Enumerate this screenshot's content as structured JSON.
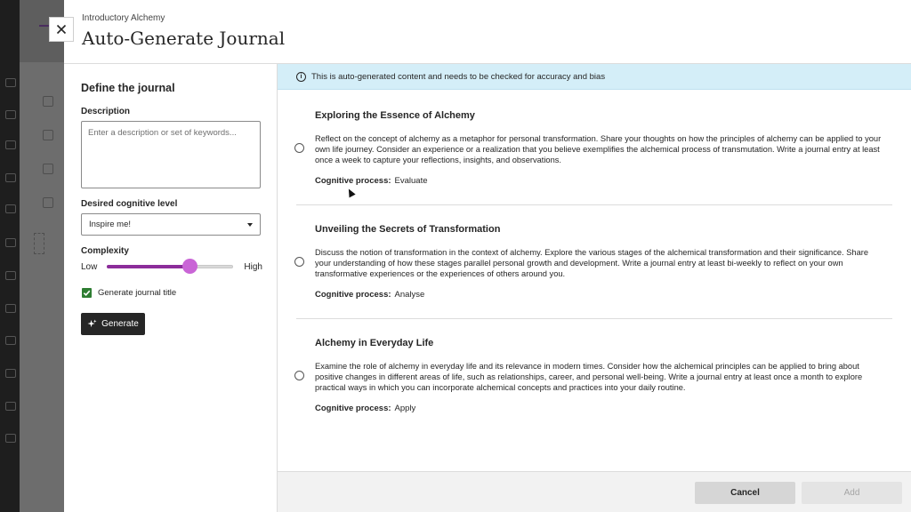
{
  "header": {
    "course": "Introductory Alchemy",
    "title": "Auto-Generate Journal"
  },
  "left": {
    "section_title": "Define the journal",
    "description_label": "Description",
    "description_placeholder": "Enter a description or set of keywords...",
    "cognitive_label": "Desired cognitive level",
    "cognitive_value": "Inspire me!",
    "complexity_label": "Complexity",
    "complexity_low": "Low",
    "complexity_high": "High",
    "complexity_fraction": 0.66,
    "generate_title_label": "Generate journal title",
    "generate_title_checked": true,
    "generate_button": "Generate"
  },
  "banner": {
    "text": "This is auto-generated content and needs to be checked for accuracy and bias"
  },
  "options": [
    {
      "title": "Exploring the Essence of Alchemy",
      "description": "Reflect on the concept of alchemy as a metaphor for personal transformation. Share your thoughts on how the principles of alchemy can be applied to your own life journey. Consider an experience or a realization that you believe exemplifies the alchemical process of transmutation. Write a journal entry at least once a week to capture your reflections, insights, and observations.",
      "cognitive_label": "Cognitive process:",
      "cognitive_value": "Evaluate"
    },
    {
      "title": "Unveiling the Secrets of Transformation",
      "description": "Discuss the notion of transformation in the context of alchemy. Explore the various stages of the alchemical transformation and their significance. Share your understanding of how these stages parallel personal growth and development. Write a journal entry at least bi-weekly to reflect on your own transformative experiences or the experiences of others around you.",
      "cognitive_label": "Cognitive process:",
      "cognitive_value": "Analyse"
    },
    {
      "title": "Alchemy in Everyday Life",
      "description": "Examine the role of alchemy in everyday life and its relevance in modern times. Consider how the alchemical principles can be applied to bring about positive changes in different areas of life, such as relationships, career, and personal well-being. Write a journal entry at least once a month to explore practical ways in which you can incorporate alchemical concepts and practices into your daily routine.",
      "cognitive_label": "Cognitive process:",
      "cognitive_value": "Apply"
    }
  ],
  "footer": {
    "cancel": "Cancel",
    "add": "Add"
  },
  "colors": {
    "accent": "#8c2d9a",
    "banner": "#d4eef8",
    "checkbox": "#2e7d32"
  }
}
